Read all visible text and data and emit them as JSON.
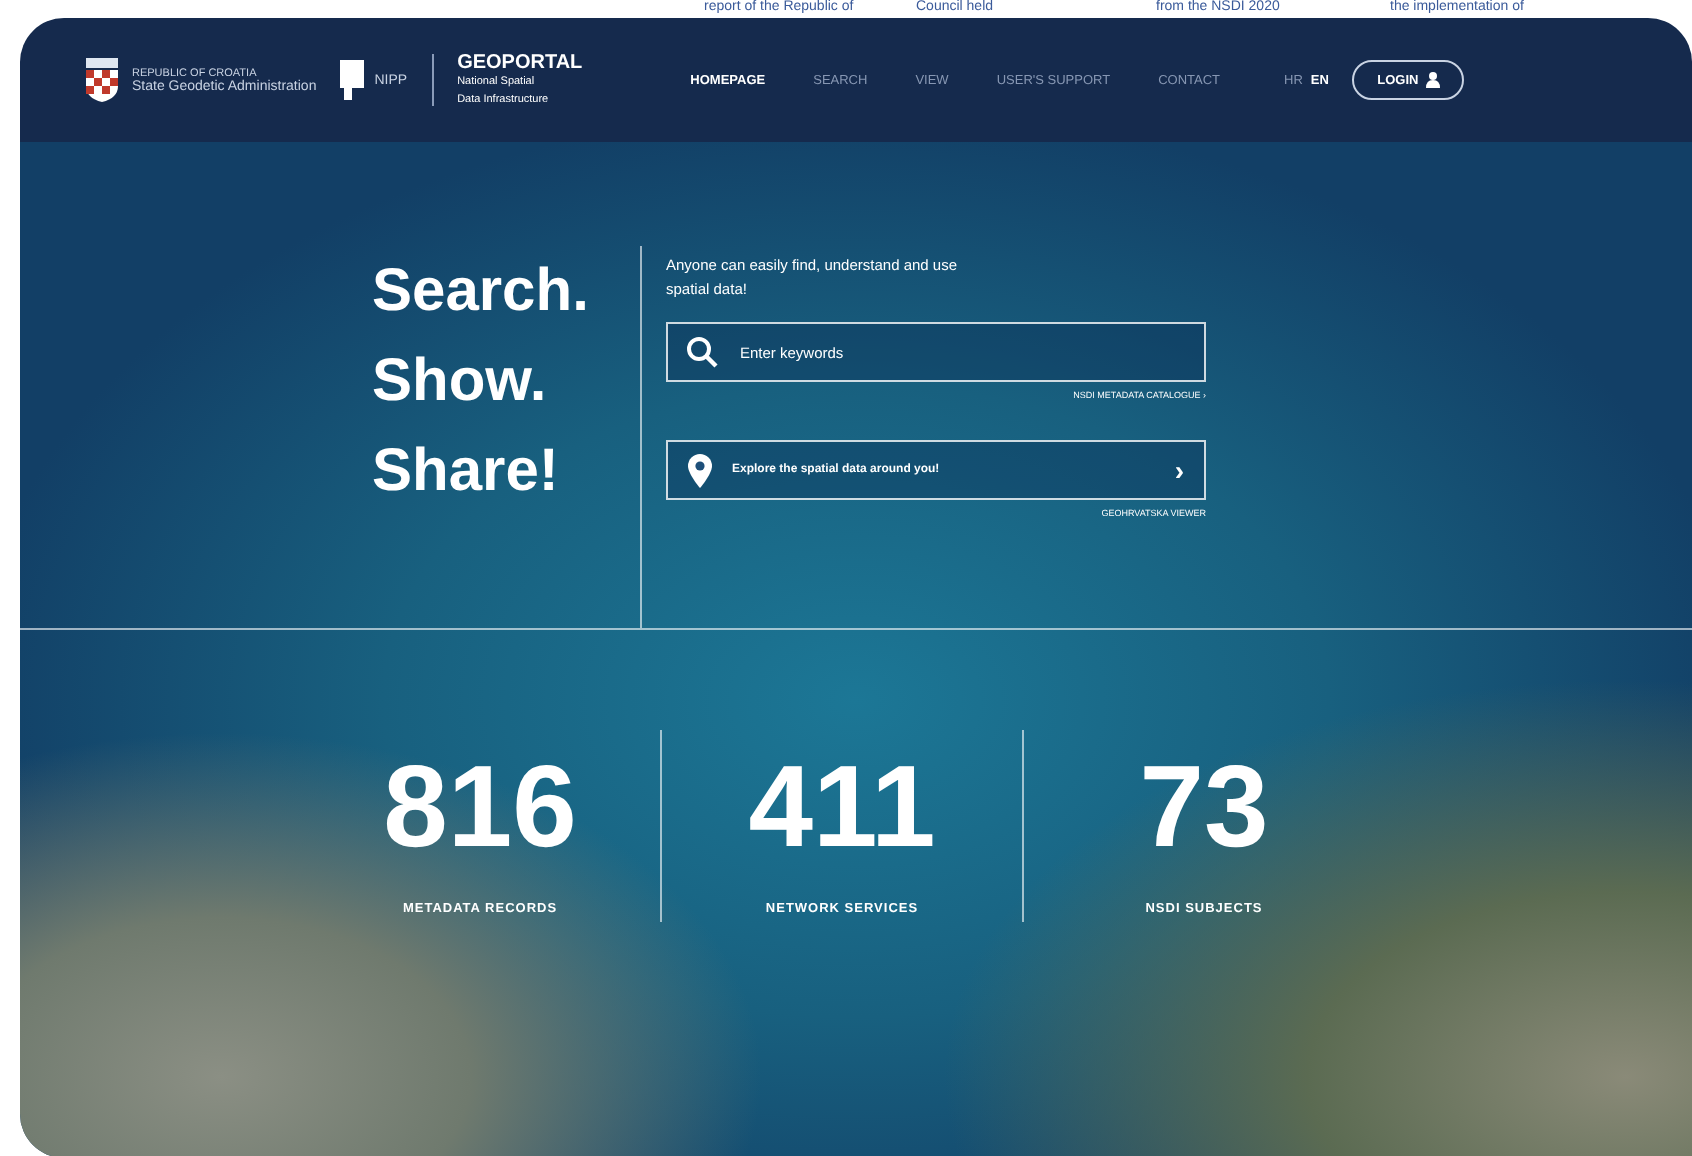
{
  "background_headlines": [
    "report of the Republic of",
    "Council held",
    "from the NSDI 2020",
    "the implementation of"
  ],
  "header": {
    "org_country": "REPUBLIC OF CROATIA",
    "org_name": "State Geodetic Administration",
    "partner_logo_text": "NIPP",
    "site_title": "GEOPORTAL",
    "site_subtitle": [
      "National Spatial",
      "Data Infrastructure"
    ],
    "nav": [
      {
        "label": "HOMEPAGE",
        "selected": true
      },
      {
        "label": "SEARCH",
        "selected": false
      },
      {
        "label": "VIEW",
        "selected": false
      },
      {
        "label": "USER'S SUPPORT",
        "selected": false
      },
      {
        "label": "CONTACT",
        "selected": false
      }
    ],
    "languages": [
      {
        "label": "HR",
        "selected": false
      },
      {
        "label": "EN",
        "selected": true
      }
    ],
    "login": "LOGIN"
  },
  "hero": {
    "tagline": [
      "Search.",
      "Show.",
      "Share!"
    ],
    "intro": "Anyone can easily find, understand and use spatial data!",
    "search": {
      "placeholder": "Enter keywords"
    },
    "search_link": "NSDI METADATA CATALOGUE ›",
    "explore": {
      "label": "Explore the spatial data around you!",
      "arrow": "›"
    },
    "explore_link": "GEOHRVATSKA VIEWER"
  },
  "stats": [
    {
      "value": "816",
      "label": "METADATA RECORDS"
    },
    {
      "value": "411",
      "label": "NETWORK SERVICES"
    },
    {
      "value": "73",
      "label": "NSDI SUBJECTS"
    }
  ]
}
